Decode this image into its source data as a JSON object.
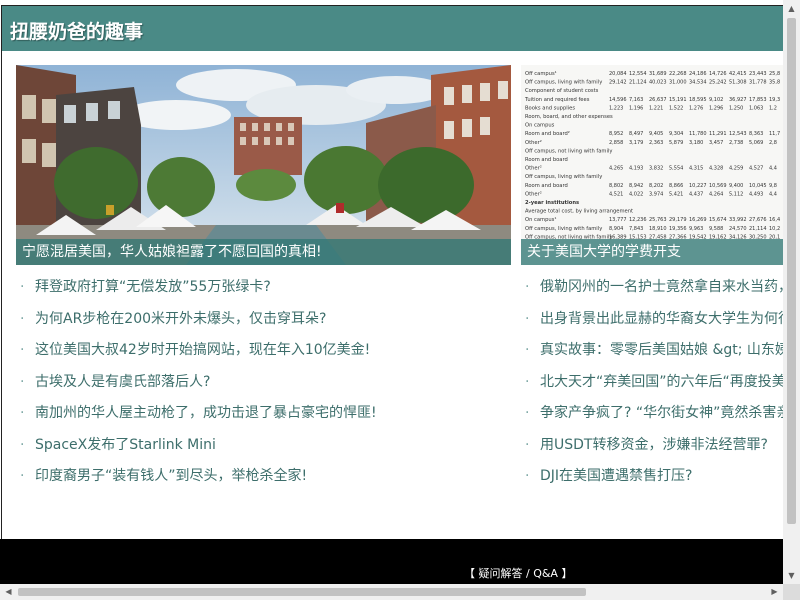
{
  "site": {
    "title": "扭腰奶爸的趣事"
  },
  "features": [
    {
      "caption": "宁愿混居美国，华人姑娘袒露了不愿回国的真相!",
      "image": "street-festival-photo"
    },
    {
      "caption": "关于美国大学的学费开支",
      "image": "tuition-table-scan"
    }
  ],
  "news_left": [
    "拜登政府打算“无偿发放”55万张绿卡?",
    "为何AR步枪在200米开外未爆头，仅击穿耳朵?",
    "这位美国大叔42岁时开始搞网站，现在年入10亿美金!",
    "古埃及人是有虞氏部落后人?",
    "南加州的华人屋主动枪了，成功击退了暴占豪宅的悍匪!",
    "SpaceX发布了Starlink Mini",
    "印度裔男子“装有钱人”到尽头，举枪杀全家!"
  ],
  "news_right": [
    "俄勒冈州的一名护士竟然拿自来水当药，",
    "出身背景出此显赫的华裔女大学生为何行",
    "真实故事：零零后美国姑娘 &gt; 山东姨",
    "北大天才“弃美回国”的六年后“再度投美",
    "争家产争疯了? “华尔街女神”竟然杀害亲",
    "用USDT转移资金，涉嫌非法经营罪?",
    "DJI在美国遭遇禁售打压?"
  ],
  "tuition_table": {
    "rows": [
      [
        "Off campus¹",
        "20,084",
        "12,554",
        "31,689",
        "22,268",
        "24,186",
        "14,726",
        "42,415",
        "23,443",
        "25,8"
      ],
      [
        "Off campus, living with family",
        "29,142",
        "21,124",
        "40,023",
        "31,000",
        "34,534",
        "25,242",
        "51,308",
        "31,778",
        "35,8"
      ],
      [
        "Component of student costs",
        "",
        "",
        "",
        "",
        "",
        "",
        "",
        "",
        ""
      ],
      [
        "Tuition and required fees",
        "14,596",
        "7,163",
        "26,637",
        "15,191",
        "18,595",
        "9,102",
        "36,927",
        "17,853",
        "19,3"
      ],
      [
        "Books and supplies",
        "1,223",
        "1,196",
        "1,221",
        "1,522",
        "1,276",
        "1,296",
        "1,250",
        "1,063",
        "1,2"
      ],
      [
        "Room, board, and other expenses",
        "",
        "",
        "",
        "",
        "",
        "",
        "",
        "",
        ""
      ],
      [
        "On campus",
        "",
        "",
        "",
        "",
        "",
        "",
        "",
        "",
        ""
      ],
      [
        "Room and board²",
        "8,952",
        "8,497",
        "9,405",
        "9,304",
        "11,780",
        "11,291",
        "12,543",
        "8,363",
        "11,7"
      ],
      [
        "Other²",
        "2,858",
        "3,179",
        "2,363",
        "5,879",
        "3,180",
        "3,457",
        "2,738",
        "5,069",
        "2,8"
      ],
      [
        "Off campus, not living with family",
        "",
        "",
        "",
        "",
        "",
        "",
        "",
        "",
        ""
      ],
      [
        "Room and board",
        "",
        "",
        "",
        "",
        "",
        "",
        "",
        "",
        ""
      ],
      [
        "Other²",
        "4,265",
        "4,193",
        "3,832",
        "5,554",
        "4,315",
        "4,328",
        "4,259",
        "4,527",
        "4,4"
      ],
      [
        "Off campus, living with family",
        "",
        "",
        "",
        "",
        "",
        "",
        "",
        "",
        ""
      ],
      [
        "Room and board",
        "8,802",
        "8,942",
        "8,202",
        "8,866",
        "10,227",
        "10,569",
        "9,400",
        "10,045",
        "9,8"
      ],
      [
        "Other²",
        "4,521",
        "4,022",
        "3,974",
        "5,421",
        "4,437",
        "4,264",
        "5,112",
        "4,493",
        "4,4"
      ],
      [
        "2-year institutions",
        "",
        "",
        "",
        "",
        "",
        "",
        "",
        "",
        ""
      ],
      [
        "Average total cost, by living arrangement",
        "",
        "",
        "",
        "",
        "",
        "",
        "",
        "",
        ""
      ],
      [
        "On campus¹",
        "13,777",
        "12,236",
        "25,763",
        "29,179",
        "16,269",
        "15,674",
        "33,992",
        "27,676",
        "16,4"
      ],
      [
        "Off campus, living with family",
        "8,904",
        "7,843",
        "18,910",
        "19,356",
        "9,963",
        "9,588",
        "24,570",
        "21,114",
        "10,2"
      ],
      [
        "Off campus, not living with family",
        "16,389",
        "15,153",
        "27,458",
        "27,366",
        "19,542",
        "19,162",
        "34,126",
        "30,250",
        "20,1"
      ]
    ]
  },
  "footer": {
    "link": "【 疑问解答 / Q&A 】"
  },
  "colors": {
    "header": "#4a8a86",
    "caption_bg": "#327874",
    "link": "#3d6e6b",
    "footer": "#000000"
  }
}
